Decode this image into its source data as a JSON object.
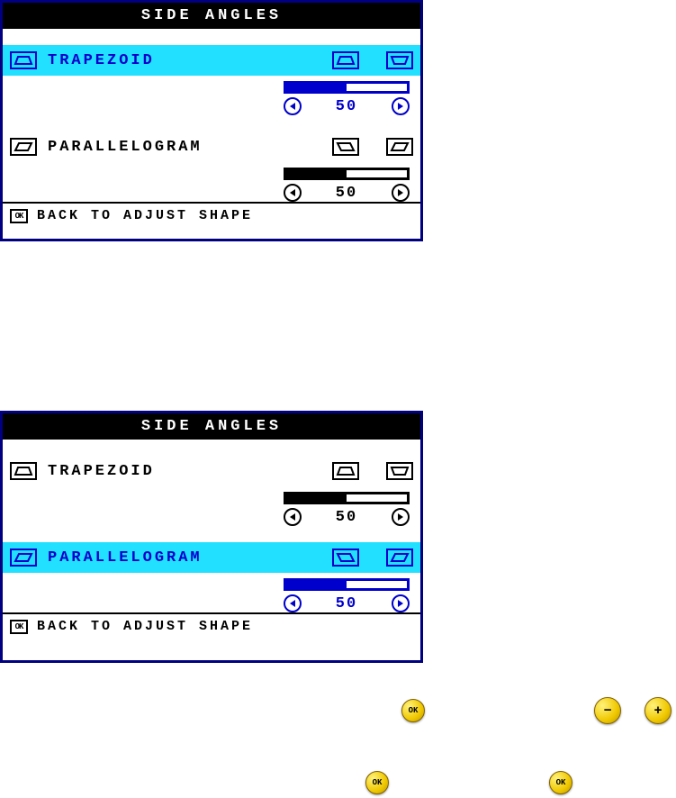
{
  "panels": [
    {
      "title": "SIDE ANGLES",
      "items": [
        {
          "label": "TRAPEZOID",
          "value": 50,
          "fill": 50,
          "selected": true
        },
        {
          "label": "PARALLELOGRAM",
          "value": 50,
          "fill": 50,
          "selected": false
        }
      ],
      "footer": "BACK TO ADJUST SHAPE"
    },
    {
      "title": "SIDE ANGLES",
      "items": [
        {
          "label": "TRAPEZOID",
          "value": 50,
          "fill": 50,
          "selected": false
        },
        {
          "label": "PARALLELOGRAM",
          "value": 50,
          "fill": 50,
          "selected": true
        }
      ],
      "footer": "BACK TO ADJUST SHAPE"
    }
  ],
  "buttons": {
    "ok": "OK",
    "minus": "−",
    "plus": "+"
  }
}
